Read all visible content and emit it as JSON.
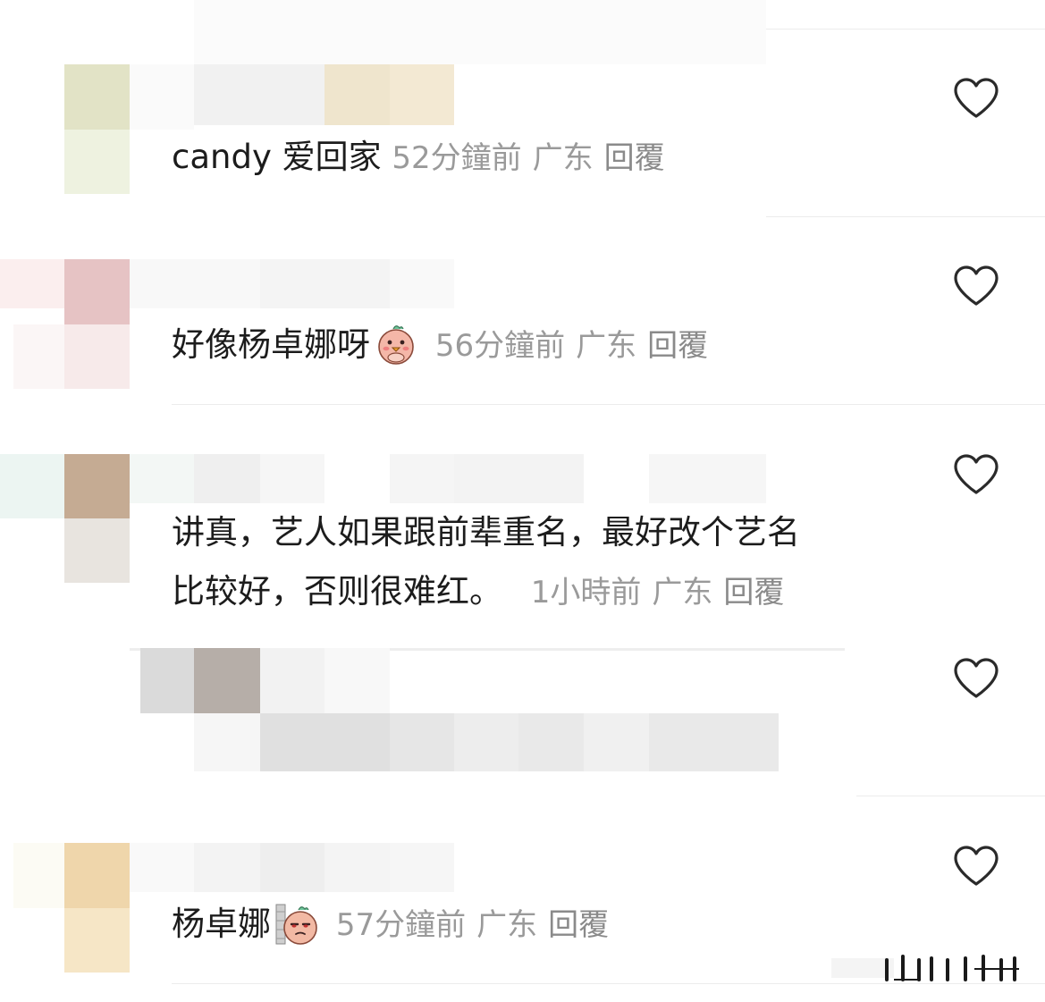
{
  "comments": [
    {
      "text": "candy 爱回家",
      "time": "52分鐘前",
      "location": "广东",
      "reply": "回覆"
    },
    {
      "text": "好像杨卓娜呀",
      "emoji": "blushing-chick-emoji",
      "time": "56分鐘前",
      "location": "广东",
      "reply": "回覆"
    },
    {
      "text_line1": "讲真，艺人如果跟前辈重名，最好改个艺名",
      "text_line2": "比较好，否则很难红。",
      "time": "1小時前",
      "location": "广东",
      "reply": "回覆"
    },
    {
      "blurred": true
    },
    {
      "text": "杨卓娜",
      "emoji": "peeking-smug-emoji",
      "time": "57分鐘前",
      "location": "广东",
      "reply": "回覆"
    }
  ],
  "icons": {
    "like": "heart-outline-icon"
  },
  "colors": {
    "text": "#1c1c1c",
    "meta": "#9a9a9a",
    "divider": "#ececec"
  }
}
